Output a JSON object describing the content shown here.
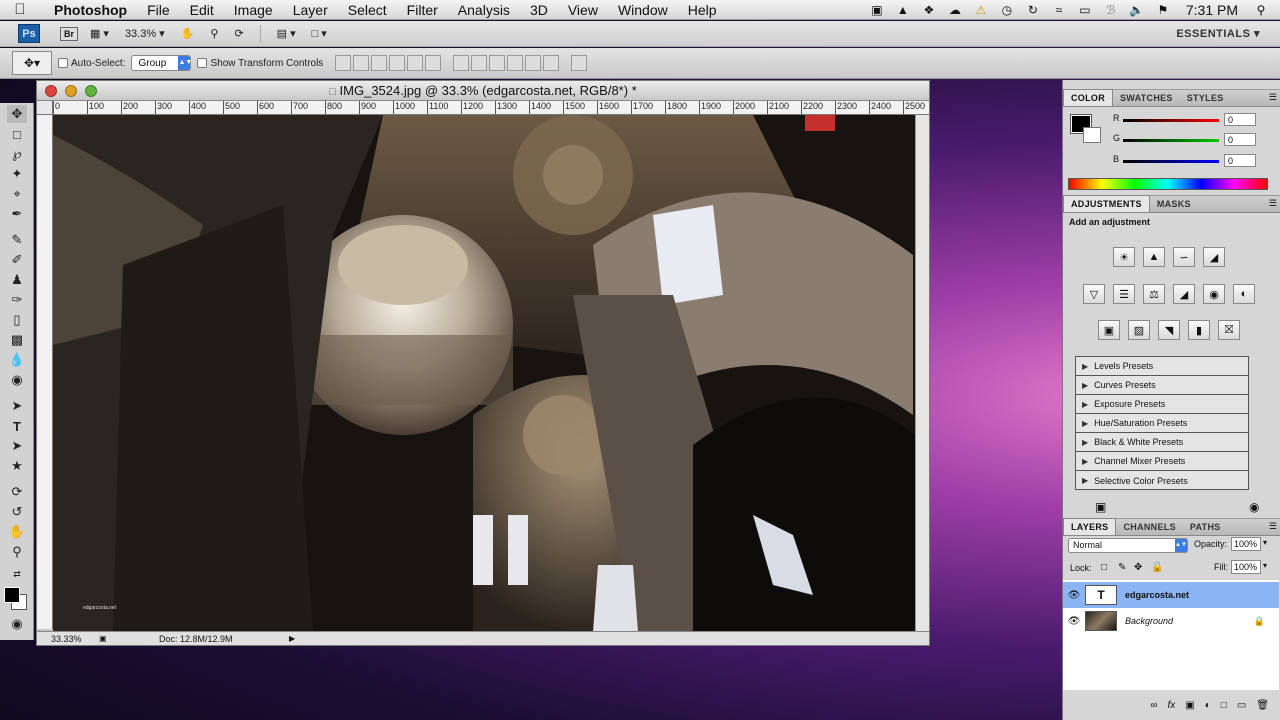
{
  "menubar": {
    "app": "Photoshop",
    "items": [
      "File",
      "Edit",
      "Image",
      "Layer",
      "Select",
      "Filter",
      "Analysis",
      "3D",
      "View",
      "Window",
      "Help"
    ],
    "clock": "7:31 PM"
  },
  "appbar": {
    "ps_logo": "Ps",
    "br_logo": "Br",
    "zoom": "33.3%",
    "workspace": "ESSENTIALS"
  },
  "options": {
    "auto_select_label": "Auto-Select:",
    "auto_select_value": "Group",
    "show_transform_label": "Show Transform Controls"
  },
  "document": {
    "title": "IMG_3524.jpg @ 33.3% (edgarcosta.net, RGB/8*) *",
    "ruler_marks": [
      "0",
      "100",
      "200",
      "300",
      "400",
      "500",
      "600",
      "700",
      "800",
      "900",
      "1000",
      "1100",
      "1200",
      "1300",
      "1400",
      "1500",
      "1600",
      "1700",
      "1800",
      "1900",
      "2000",
      "2100",
      "2200",
      "2300",
      "2400",
      "2500"
    ],
    "status_zoom": "33.33%",
    "status_doc": "Doc: 12.8M/12.9M",
    "watermark": "edgarcosta.net"
  },
  "color_panel": {
    "tabs": [
      "COLOR",
      "SWATCHES",
      "STYLES"
    ],
    "r_label": "R",
    "g_label": "G",
    "b_label": "B",
    "r": "0",
    "g": "0",
    "b": "0"
  },
  "adjustments": {
    "tabs": [
      "ADJUSTMENTS",
      "MASKS"
    ],
    "heading": "Add an adjustment",
    "presets": [
      "Levels Presets",
      "Curves Presets",
      "Exposure Presets",
      "Hue/Saturation Presets",
      "Black & White Presets",
      "Channel Mixer Presets",
      "Selective Color Presets"
    ]
  },
  "layers": {
    "tabs": [
      "LAYERS",
      "CHANNELS",
      "PATHS"
    ],
    "blend_mode": "Normal",
    "opacity_label": "Opacity:",
    "opacity": "100%",
    "lock_label": "Lock:",
    "fill_label": "Fill:",
    "fill": "100%",
    "rows": [
      {
        "name": "edgarcosta.net",
        "thumb": "T"
      },
      {
        "name": "Background",
        "thumb": ""
      }
    ]
  },
  "colors": {
    "accent": "#8ab4f4",
    "ps_blue": "#1d5fa6"
  }
}
